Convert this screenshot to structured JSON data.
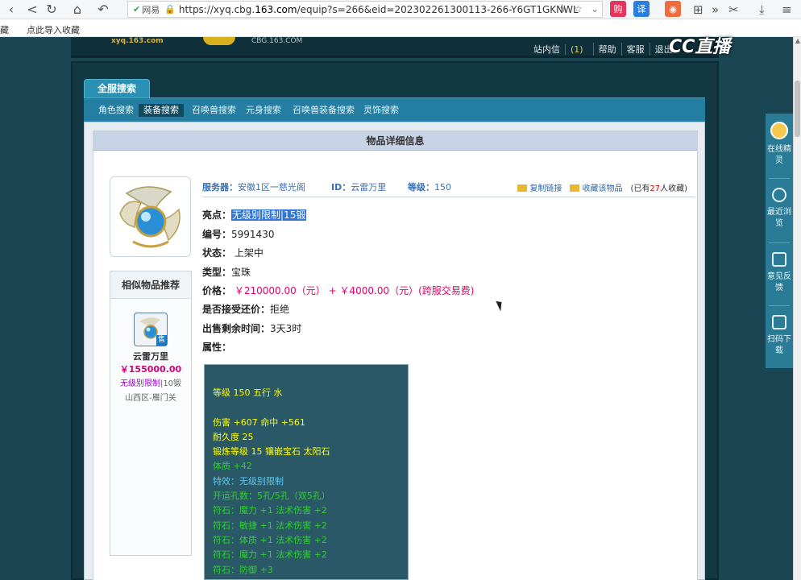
{
  "browser": {
    "url_site_label": "网易",
    "url_prefix": "https://xyq.cbg.",
    "url_domain": "163.com",
    "url_path": "/equip?s=266&eid=202302261300113-266-Y6GT1GKNWL",
    "bookmark_1": "藏",
    "bookmark_2": "点此导入收藏"
  },
  "site": {
    "logo_text": "xyq.163.com",
    "cbg_text": "CBG.163.COM",
    "nav": {
      "messages": "站内信",
      "messages_count": "(1)",
      "help": "帮助",
      "service": "客服",
      "logout": "退出"
    },
    "stream_logo": "CC直播"
  },
  "tabs": {
    "main": "全服搜索",
    "sub": [
      "角色搜索",
      "装备搜索",
      "召唤兽搜索",
      "元身搜索",
      "召唤兽装备搜索",
      "灵饰搜索"
    ]
  },
  "panel_title": "物品详细信息",
  "similar": {
    "title": "相似物品推荐",
    "sold_tag": "售",
    "name": "云雷万里",
    "price": "￥155000.00",
    "desc": "无级别限制",
    "desc_level": "|10锻",
    "server": "山西区-雁门关"
  },
  "meta": {
    "server_label": "服务器：",
    "server_value": "安徽1区一慈光阁",
    "id_label": "ID：",
    "id_value": "云雷万里",
    "level_label": "等级：",
    "level_value": "150",
    "copy_link": "复制链接",
    "favorite": "收藏该物品",
    "fav_prefix": "(已有",
    "fav_count": "27",
    "fav_suffix": "人收藏)"
  },
  "details": {
    "highlight_label": "亮点：",
    "highlight_value": "无级别限制|15锻",
    "serial_label": "编号：",
    "serial_value": "5991430",
    "status_label": "状态：",
    "status_value": "上架中",
    "type_label": "类型：",
    "type_value": "宝珠",
    "price_label": "价格：",
    "price_value": "￥210000.00（元）",
    "price_plus": "+",
    "price_fee": "￥4000.00（元）",
    "price_fee_note": "(跨服交易费)",
    "bargain_label": "是否接受还价：",
    "bargain_value": "拒绝",
    "remaining_label": "出售剩余时间：",
    "remaining_value": "3天3时",
    "attr_label": "属性："
  },
  "stats": {
    "line1": "等级 150  五行 水",
    "line2": "伤害 +607 命中 +561",
    "line3": "耐久度 25",
    "line4": "锻炼等级 15  镶嵌宝石 太阳石",
    "line5": "体质 +42",
    "line6": "特效：无级别限制",
    "line7": "开运孔数：5孔/5孔（双5孔）",
    "line8": "符石：魔力 +1  法术伤害 +2",
    "line9": "符石：敏捷 +1  法术伤害 +2",
    "line10": "符石：体质 +1  法术伤害 +2",
    "line11": "符石：魔力 +1  法术伤害 +2",
    "line12": "符石：防御 +3"
  },
  "float_bar": {
    "online": "在线精灵",
    "recent": "最近浏览",
    "feedback": "意见反馈",
    "download": "扫码下载"
  },
  "colors": {
    "accent": "#2a91b4",
    "price": "#e0006a",
    "stat_yellow": "#ffff00",
    "stat_green": "#2ed030",
    "stat_blue": "#5cc8f0"
  }
}
